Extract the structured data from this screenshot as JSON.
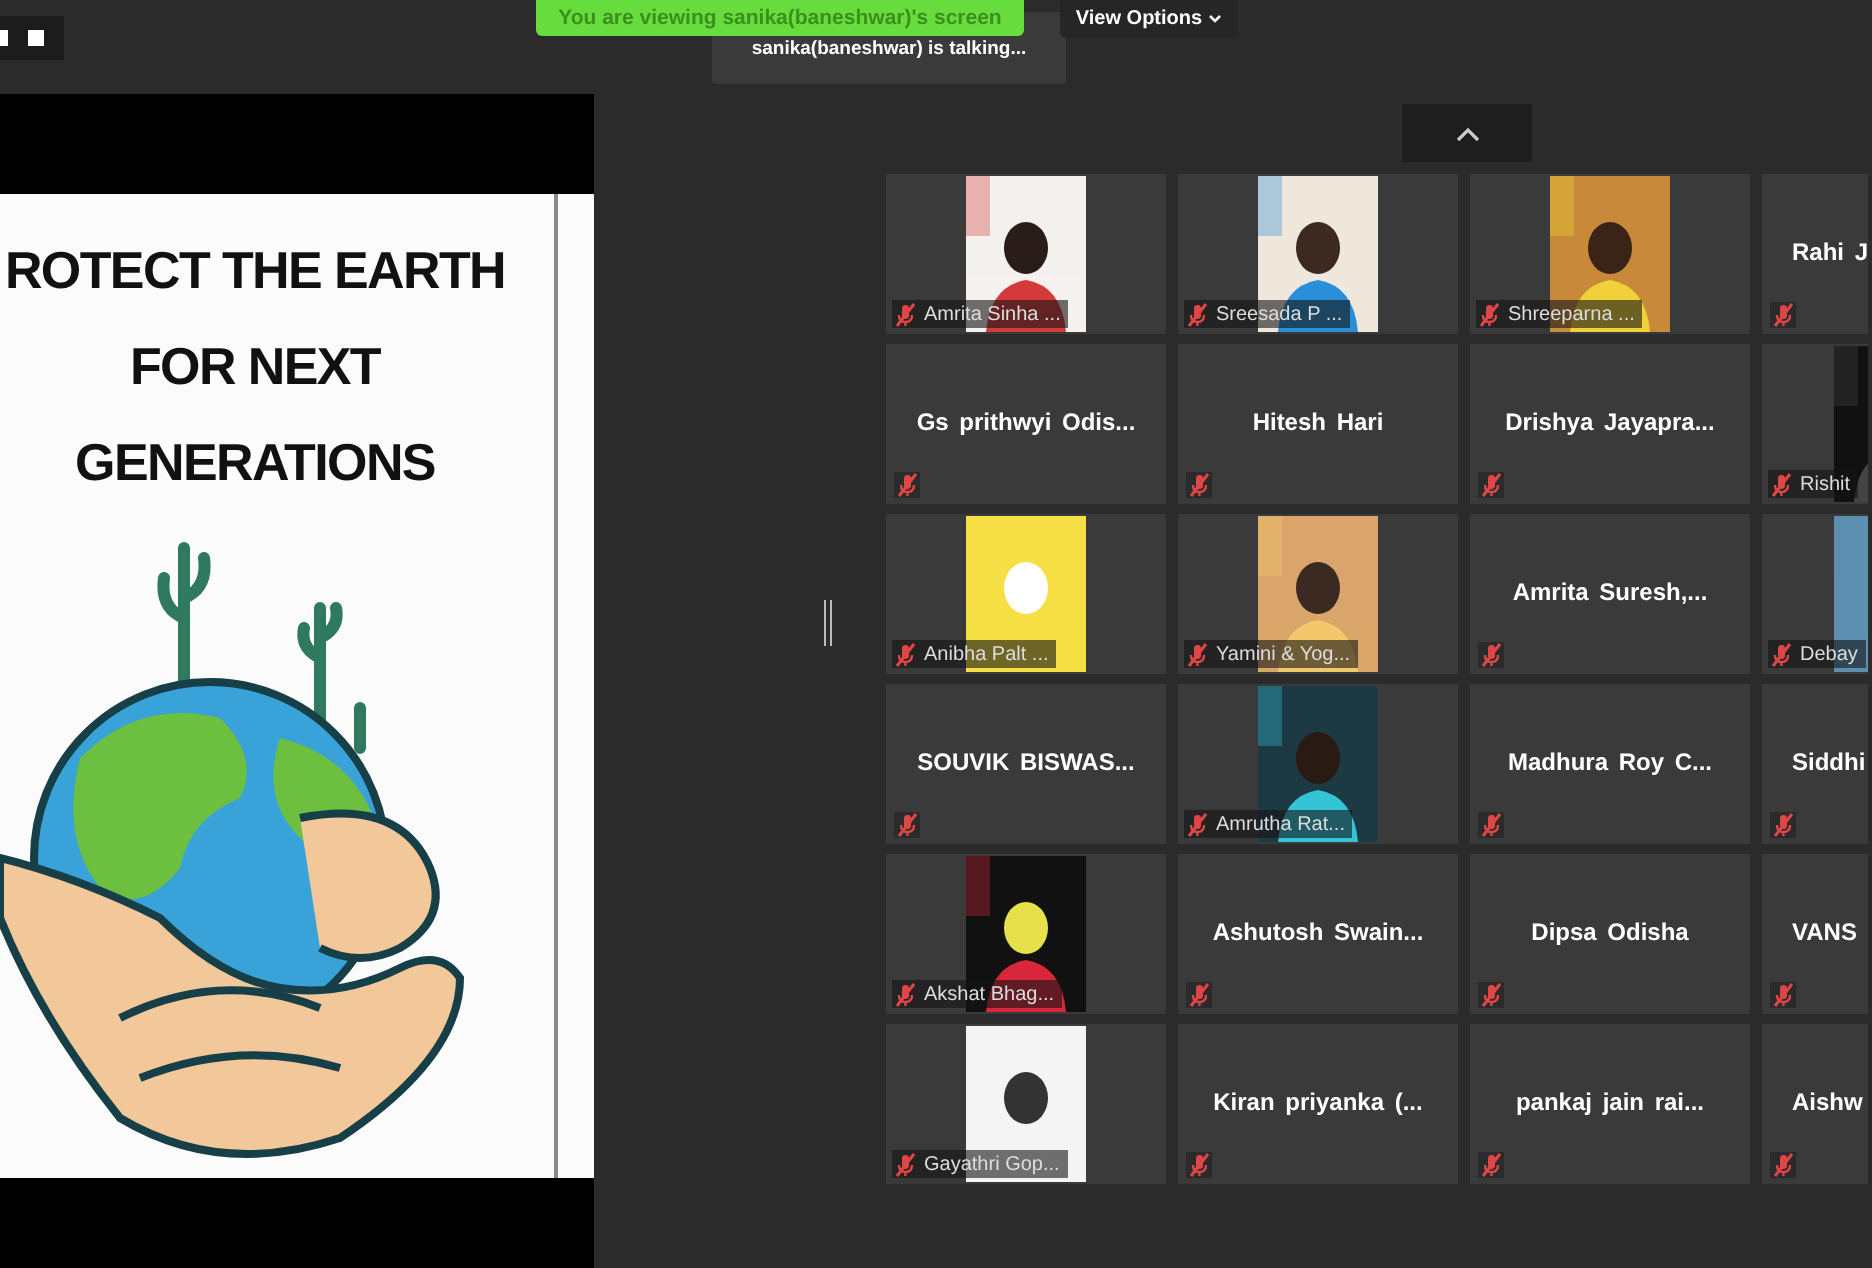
{
  "top_bar": {
    "viewing_banner": "You are viewing sanika(baneshwar)'s screen",
    "view_options": "View Options",
    "talking_indicator": "sanika(baneshwar) is talking..."
  },
  "shared_screen": {
    "slide_lines": [
      "ROTECT THE EARTH",
      "FOR NEXT",
      "GENERATIONS"
    ]
  },
  "participants": [
    {
      "name": "Amrita Sinha ...",
      "kind": "video",
      "muted": true
    },
    {
      "name": "Sreesada P ...",
      "kind": "video",
      "muted": true
    },
    {
      "name": "Shreeparna ...",
      "kind": "video",
      "muted": true
    },
    {
      "name": "Rahi J",
      "kind": "name",
      "muted": true
    },
    {
      "name": "Gs prithwyi Odis...",
      "kind": "name",
      "muted": true
    },
    {
      "name": "Hitesh Hari",
      "kind": "name",
      "muted": true
    },
    {
      "name": "Drishya Jayapra...",
      "kind": "name",
      "muted": true
    },
    {
      "name": "Rishit",
      "kind": "video",
      "muted": true
    },
    {
      "name": "Anibha Palt ...",
      "kind": "video",
      "muted": true
    },
    {
      "name": "Yamini & Yog...",
      "kind": "video",
      "muted": true
    },
    {
      "name": "Amrita Suresh,...",
      "kind": "name",
      "muted": true
    },
    {
      "name": "Debay",
      "kind": "video",
      "muted": true
    },
    {
      "name": "SOUVIK BISWAS...",
      "kind": "name",
      "muted": true
    },
    {
      "name": "Amrutha Rat...",
      "kind": "video",
      "muted": true
    },
    {
      "name": "Madhura Roy C...",
      "kind": "name",
      "muted": true
    },
    {
      "name": "Siddhi",
      "kind": "name",
      "muted": true
    },
    {
      "name": "Akshat Bhag...",
      "kind": "video",
      "muted": true
    },
    {
      "name": "Ashutosh Swain...",
      "kind": "name",
      "muted": true
    },
    {
      "name": "Dipsa Odisha",
      "kind": "name",
      "muted": true
    },
    {
      "name": "VANS",
      "kind": "name",
      "muted": true
    },
    {
      "name": "Gayathri Gop...",
      "kind": "video",
      "muted": true
    },
    {
      "name": "Kiran priyanka (...",
      "kind": "name",
      "muted": true
    },
    {
      "name": "pankaj jain rai...",
      "kind": "name",
      "muted": true
    },
    {
      "name": "Aishw",
      "kind": "name",
      "muted": true
    }
  ]
}
